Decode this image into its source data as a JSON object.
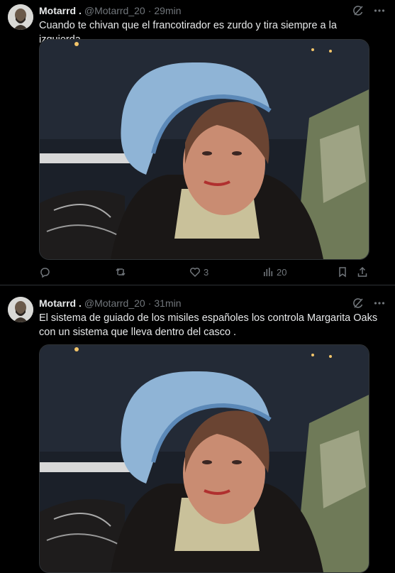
{
  "tweets": [
    {
      "author_name": "Motarrd .",
      "handle": "@Motarrd_20",
      "separator": "·",
      "time": "29min",
      "text": "Cuando te chivan que el francotirador es zurdo y tira siempre a la izquierda.",
      "actions": {
        "reply": "",
        "retweet": "",
        "likes": "3",
        "views": "20"
      }
    },
    {
      "author_name": "Motarrd .",
      "handle": "@Motarrd_20",
      "separator": "·",
      "time": "31min",
      "text_line1": "El sistema de guiado de los misiles españoles los controla Margarita Oaks",
      "text_line2": "con un sistema que lleva dentro del casco ."
    }
  ],
  "icons": {
    "grok": "grok-icon",
    "more": "more-icon",
    "reply": "reply-icon",
    "retweet": "retweet-icon",
    "like": "heart-icon",
    "views": "views-icon",
    "bookmark": "bookmark-icon",
    "share": "share-icon"
  },
  "colors": {
    "background": "#000000",
    "text": "#e7e9ea",
    "muted": "#71767b",
    "border": "#2f3336"
  }
}
